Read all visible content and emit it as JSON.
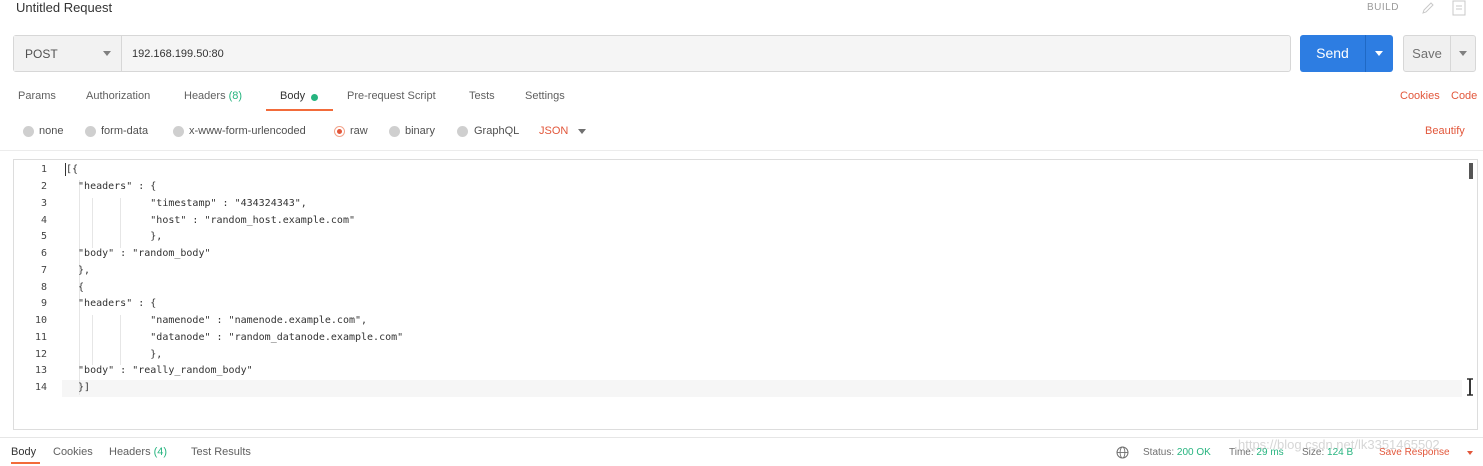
{
  "window": {
    "title": "Untitled Request",
    "build_label": "BUILD"
  },
  "request": {
    "method": "POST",
    "url": "192.168.199.50:80",
    "send_label": "Send",
    "save_label": "Save"
  },
  "tabs": [
    {
      "label": "Params"
    },
    {
      "label": "Authorization"
    },
    {
      "label": "Headers",
      "count": "(8)"
    },
    {
      "label": "Body"
    },
    {
      "label": "Pre-request Script"
    },
    {
      "label": "Tests"
    },
    {
      "label": "Settings"
    }
  ],
  "right_links": {
    "cookies": "Cookies",
    "code": "Code"
  },
  "body_options": {
    "modes": [
      "none",
      "form-data",
      "x-www-form-urlencoded",
      "raw",
      "binary",
      "GraphQL"
    ],
    "selected": "raw",
    "format": "JSON",
    "beautify": "Beautify"
  },
  "editor": {
    "line_numbers": [
      "1",
      "2",
      "3",
      "4",
      "5",
      "6",
      "7",
      "8",
      "9",
      "10",
      "11",
      "12",
      "13",
      "14"
    ],
    "lines": [
      "[{",
      "  \"headers\" : {",
      "              \"timestamp\" : \"434324343\",",
      "              \"host\" : \"random_host.example.com\"",
      "              },",
      "  \"body\" : \"random_body\"",
      "  },",
      "  {",
      "  \"headers\" : {",
      "              \"namenode\" : \"namenode.example.com\",",
      "              \"datanode\" : \"random_datanode.example.com\"",
      "              },",
      "  \"body\" : \"really_random_body\"",
      "  }]"
    ]
  },
  "response": {
    "tabs": [
      {
        "label": "Body"
      },
      {
        "label": "Cookies"
      },
      {
        "label": "Headers",
        "count": "(4)"
      },
      {
        "label": "Test Results"
      }
    ],
    "status_label": "Status:",
    "status_value": "200 OK",
    "time_label": "Time:",
    "time_value": "29 ms",
    "size_label": "Size:",
    "size_value": "124 B",
    "save_response": "Save Response",
    "watermark": "https://blog.csdn.net/lk3351465502"
  },
  "colors": {
    "accent": "#e2573b",
    "send": "#2d7de2",
    "success": "#26b47f"
  }
}
